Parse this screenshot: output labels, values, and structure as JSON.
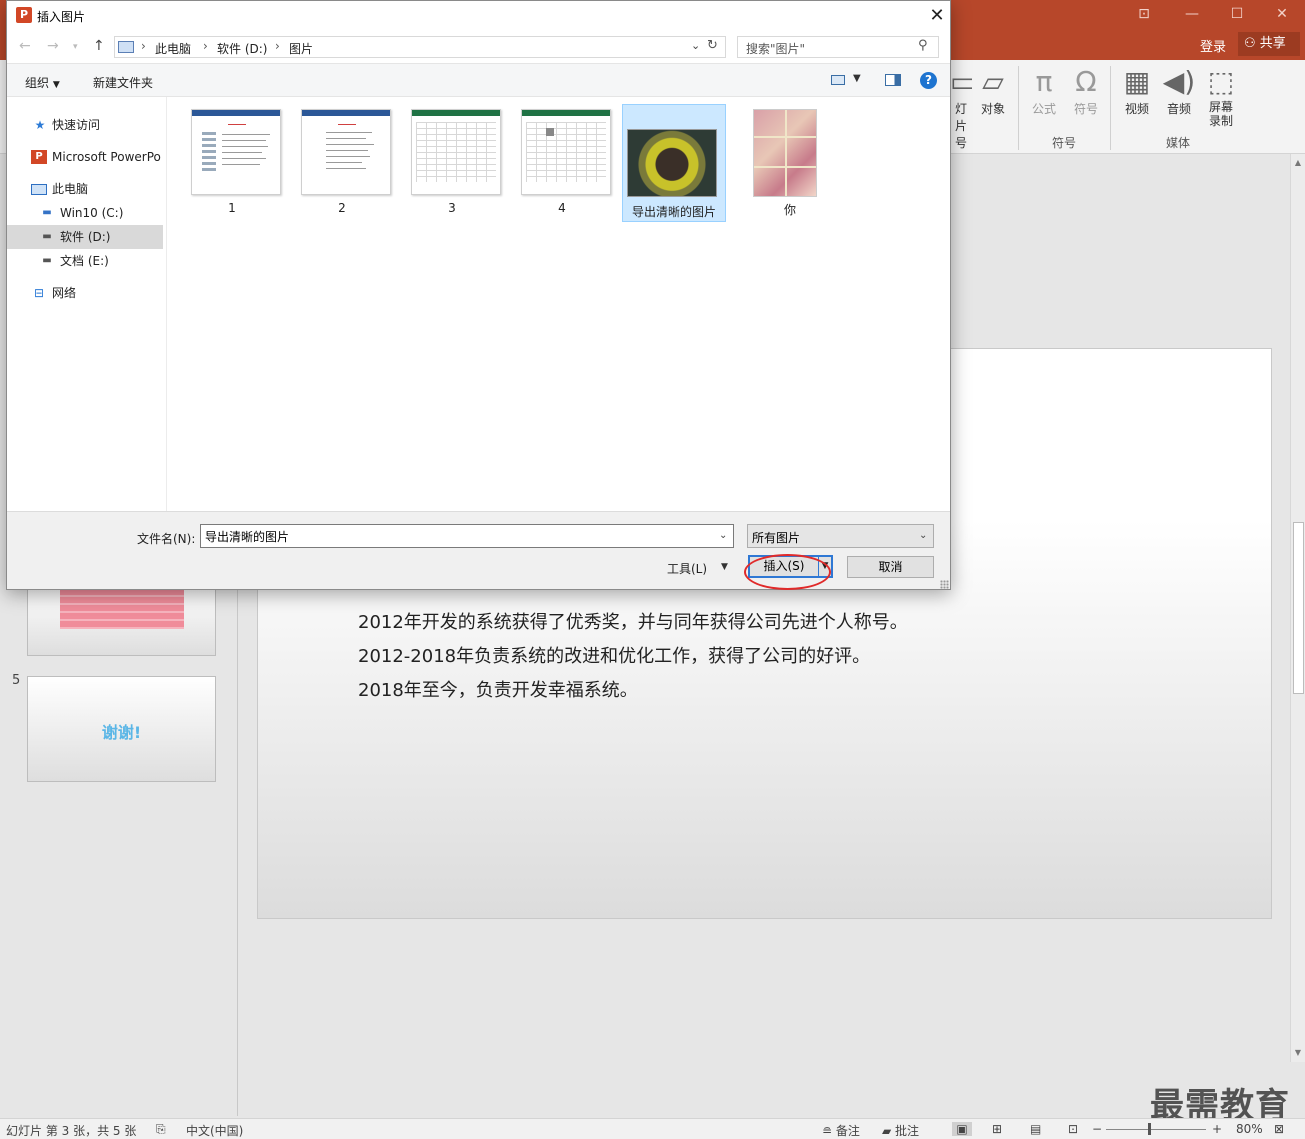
{
  "ppt": {
    "login": "登录",
    "share": "共享",
    "ribbon": {
      "partial_btn1": "灯片",
      "partial_btn1b": "号",
      "object": "对象",
      "formula": "公式",
      "symbol": "符号",
      "symbols_group": "符号",
      "video": "视频",
      "audio": "音频",
      "screen_record": "屏幕录制",
      "media_group": "媒体"
    },
    "thumbs": {
      "slide5_num": "5",
      "slide5_text": "谢谢!"
    },
    "slide": {
      "lines": [
        "2012年开发的系统获得了优秀奖，并与同年获得公司先进个人称号。",
        "2012-2018年负责系统的改进和优化工作，获得了公司的好评。",
        "2018年至今，负责开发幸福系统。"
      ]
    },
    "status": {
      "slide_info": "幻灯片 第 3 张，共 5 张",
      "language": "中文(中国)",
      "notes": "备注",
      "comments": "批注",
      "zoom": "80%"
    },
    "watermark": "最需教育"
  },
  "dialog": {
    "title": "插入图片",
    "breadcrumbs": [
      "此电脑",
      "软件 (D:)",
      "图片"
    ],
    "search_placeholder": "搜索\"图片\"",
    "toolbar": {
      "organize": "组织",
      "new_folder": "新建文件夹"
    },
    "sidebar": {
      "quick_access": "快速访问",
      "powerpoint": "Microsoft PowerPo",
      "this_pc": "此电脑",
      "drive_c": "Win10 (C:)",
      "drive_d": "软件 (D:)",
      "drive_e": "文档 (E:)",
      "network": "网络"
    },
    "files": [
      {
        "name": "1",
        "kind": "word"
      },
      {
        "name": "2",
        "kind": "word"
      },
      {
        "name": "3",
        "kind": "excel"
      },
      {
        "name": "4",
        "kind": "excel"
      },
      {
        "name": "导出清晰的图片",
        "kind": "photo",
        "selected": true
      },
      {
        "name": "你",
        "kind": "collage"
      }
    ],
    "filename_label": "文件名(N):",
    "filename_value": "导出清晰的图片",
    "filetype": "所有图片",
    "tools": "工具(L)",
    "insert": "插入(S)",
    "cancel": "取消"
  }
}
